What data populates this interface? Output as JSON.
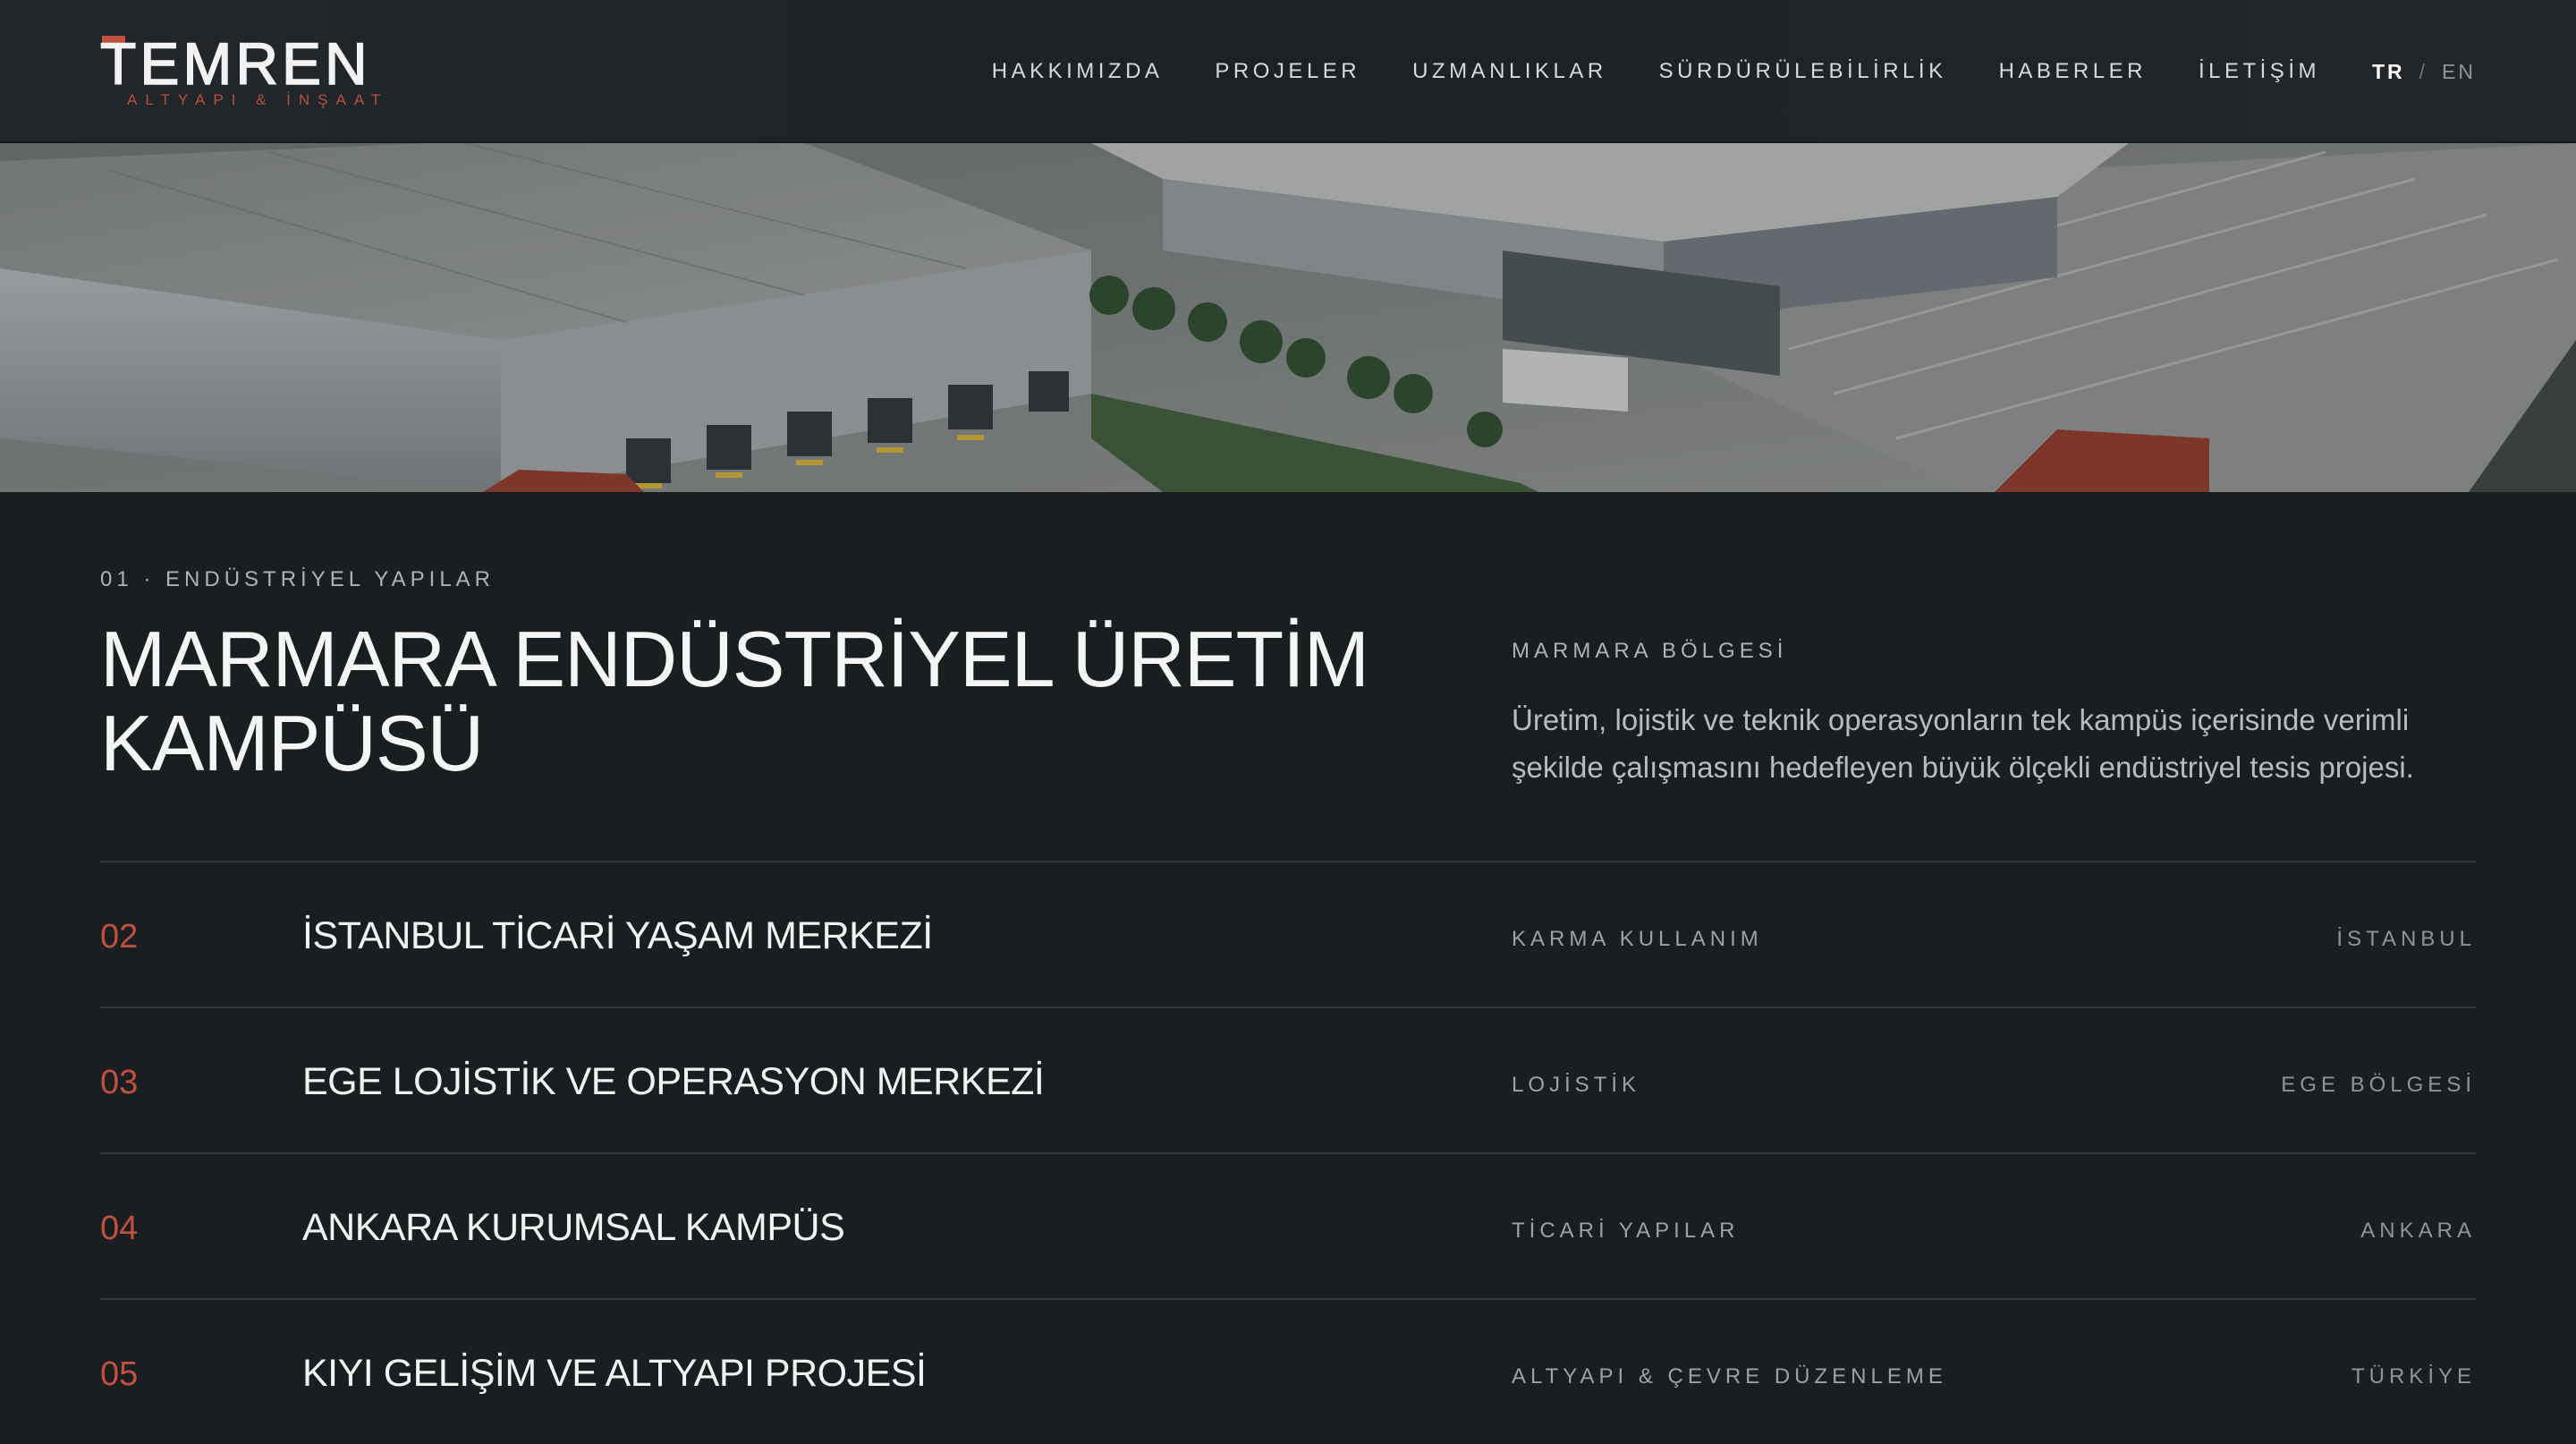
{
  "brand": {
    "name": "TEMREN",
    "tagline": "ALTYAPI & İNŞAAT",
    "accent_color": "#c0503f"
  },
  "nav": {
    "items": [
      {
        "label": "HAKKIMIZDA"
      },
      {
        "label": "PROJELER"
      },
      {
        "label": "UZMANLIKLAR"
      },
      {
        "label": "SÜRDÜRÜLEBİLİRLİK"
      },
      {
        "label": "HABERLER"
      },
      {
        "label": "İLETİŞİM"
      }
    ],
    "lang_active": "TR",
    "lang_separator": "/",
    "lang_other": "EN"
  },
  "hero": {
    "image": "aerial-industrial-warehouse-photo"
  },
  "featured": {
    "category": "01 · ENDÜSTRİYEL YAPILAR",
    "title": "MARMARA ENDÜSTRİYEL ÜRETİM KAMPÜSÜ",
    "region": "MARMARA BÖLGESİ",
    "description": "Üretim, lojistik ve teknik operasyonların tek kampüs içerisinde verimli şekilde çalışmasını hedefleyen büyük ölçekli endüstriyel tesis projesi."
  },
  "projects": [
    {
      "number": "02",
      "name": "İSTANBUL TİCARİ YAŞAM MERKEZİ",
      "category": "KARMA KULLANIM",
      "location": "İSTANBUL"
    },
    {
      "number": "03",
      "name": "EGE LOJİSTİK VE OPERASYON MERKEZİ",
      "category": "LOJİSTİK",
      "location": "EGE BÖLGESİ"
    },
    {
      "number": "04",
      "name": "ANKARA KURUMSAL KAMPÜS",
      "category": "TİCARİ YAPILAR",
      "location": "ANKARA"
    },
    {
      "number": "05",
      "name": "KIYI GELİŞİM VE ALTYAPI PROJESİ",
      "category": "ALTYAPI & ÇEVRE DÜZENLEME",
      "location": "TÜRKİYE"
    }
  ]
}
